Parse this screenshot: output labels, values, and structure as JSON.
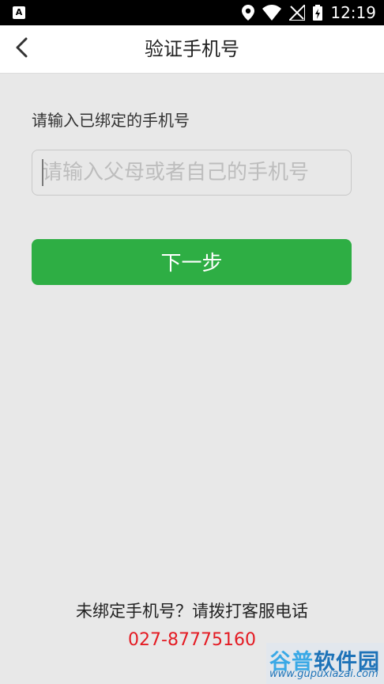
{
  "status_bar": {
    "badge": "A",
    "time": "12:19",
    "icons": [
      "location-icon",
      "wifi-icon",
      "no-signal-icon",
      "battery-charging-icon"
    ]
  },
  "header": {
    "title": "验证手机号",
    "back_icon": "chevron-left-icon"
  },
  "form": {
    "label": "请输入已绑定的手机号",
    "phone_placeholder": "请输入父母或者自己的手机号",
    "phone_value": "",
    "next_label": "下一步"
  },
  "footer": {
    "unbound_text": "未绑定手机号？请拨打客服电话",
    "hotline": "027-87775160"
  },
  "watermark": {
    "brand_part1": "谷普",
    "brand_part2": "软件园",
    "url": "www.gupuxiazai.com"
  },
  "colors": {
    "accent_green": "#2eae44",
    "hotline_red": "#e41b23",
    "background": "#e8e8e8"
  }
}
